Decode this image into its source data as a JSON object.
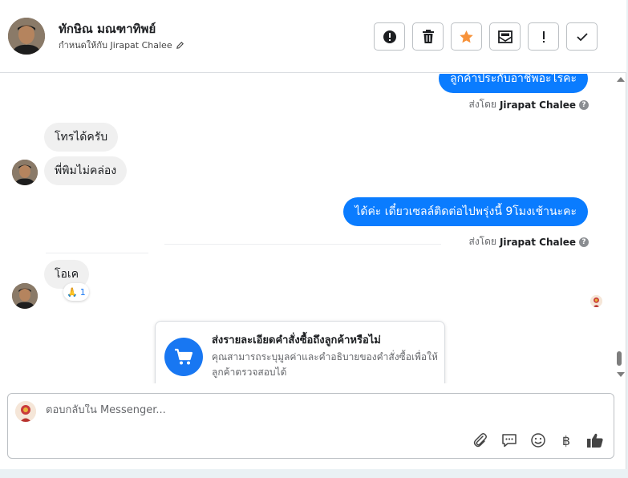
{
  "header": {
    "contact_name": "ทักษิณ มณฑาทิพย์",
    "assigned_label": "กำหนดให้กับ Jirapat Chalee",
    "actions": [
      {
        "name": "spam-button",
        "icon": "alert-circle-icon"
      },
      {
        "name": "delete-button",
        "icon": "trash-icon"
      },
      {
        "name": "star-button",
        "icon": "star-icon"
      },
      {
        "name": "mark-unread-button",
        "icon": "mail-icon"
      },
      {
        "name": "follow-up-button",
        "icon": "exclamation-icon"
      },
      {
        "name": "mark-done-button",
        "icon": "check-icon"
      }
    ]
  },
  "messages": {
    "out_1": "ลูกค้าประกับอาชีพอะไรคะ",
    "sentby_1_prefix": "ส่งโดย",
    "sentby_1_name": "Jirapat Chalee",
    "in_1": "โทรได้ครับ",
    "in_2": "พี่พิมไม่คล่อง",
    "out_2": "ได้ค่ะ เดี๋ยวเซลล์ติดต่อไปพรุ่งนี้ 9โมงเช้านะคะ",
    "sentby_2_prefix": "ส่งโดย",
    "sentby_2_name": "Jirapat Chalee",
    "in_3": "โอเค",
    "reaction_emoji": "🙏",
    "reaction_count": "1"
  },
  "order_card": {
    "title": "ส่งรายละเอียดคำสั่งซื้อถึงลูกค้าหรือไม่",
    "description": "คุณสามารถระบุมูลค่าและคำอธิบายของคำสั่งซื้อเพื่อให้ลูกค้าตรวจสอบได้",
    "icon": "cart-icon"
  },
  "composer": {
    "placeholder": "ตอบกลับใน Messenger...",
    "value": "",
    "tools": [
      "attachment-icon",
      "saved-reply-icon",
      "emoji-icon",
      "baht-icon",
      "thumbs-up-icon"
    ],
    "baht_glyph": "฿"
  },
  "colors": {
    "accent": "#0a7cff",
    "star": "#f7923a",
    "card_icon_bg": "#1877f2"
  }
}
